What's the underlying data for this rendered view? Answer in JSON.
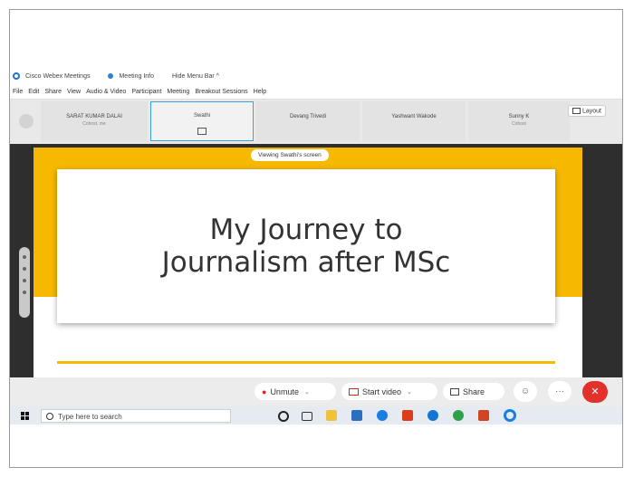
{
  "titlebar": {
    "app_name": "Cisco Webex Meetings",
    "meeting_info": "Meeting Info",
    "hide_menu": "Hide Menu Bar ^"
  },
  "menu": [
    "File",
    "Edit",
    "Share",
    "View",
    "Audio & Video",
    "Participant",
    "Meeting",
    "Breakout Sessions",
    "Help"
  ],
  "participants": [
    {
      "name": "SARAT KUMAR DALAI",
      "sub": "Cohost, me"
    },
    {
      "name": "Swathi",
      "sub": ""
    },
    {
      "name": "Devang Trivedi",
      "sub": ""
    },
    {
      "name": "Yashwant Wakode",
      "sub": ""
    },
    {
      "name": "Sunny K",
      "sub": "Cohost"
    }
  ],
  "layout_label": "Layout",
  "viewing_label": "Viewing Swathi's screen",
  "slide": {
    "line1": "My Journey to",
    "line2": "Journalism after MSc",
    "accent_color": "#f6b800"
  },
  "controls": {
    "unmute": "Unmute",
    "start_video": "Start video",
    "share": "Share",
    "end_color": "#e2302b"
  },
  "taskbar": {
    "search_placeholder": "Type here to search"
  }
}
